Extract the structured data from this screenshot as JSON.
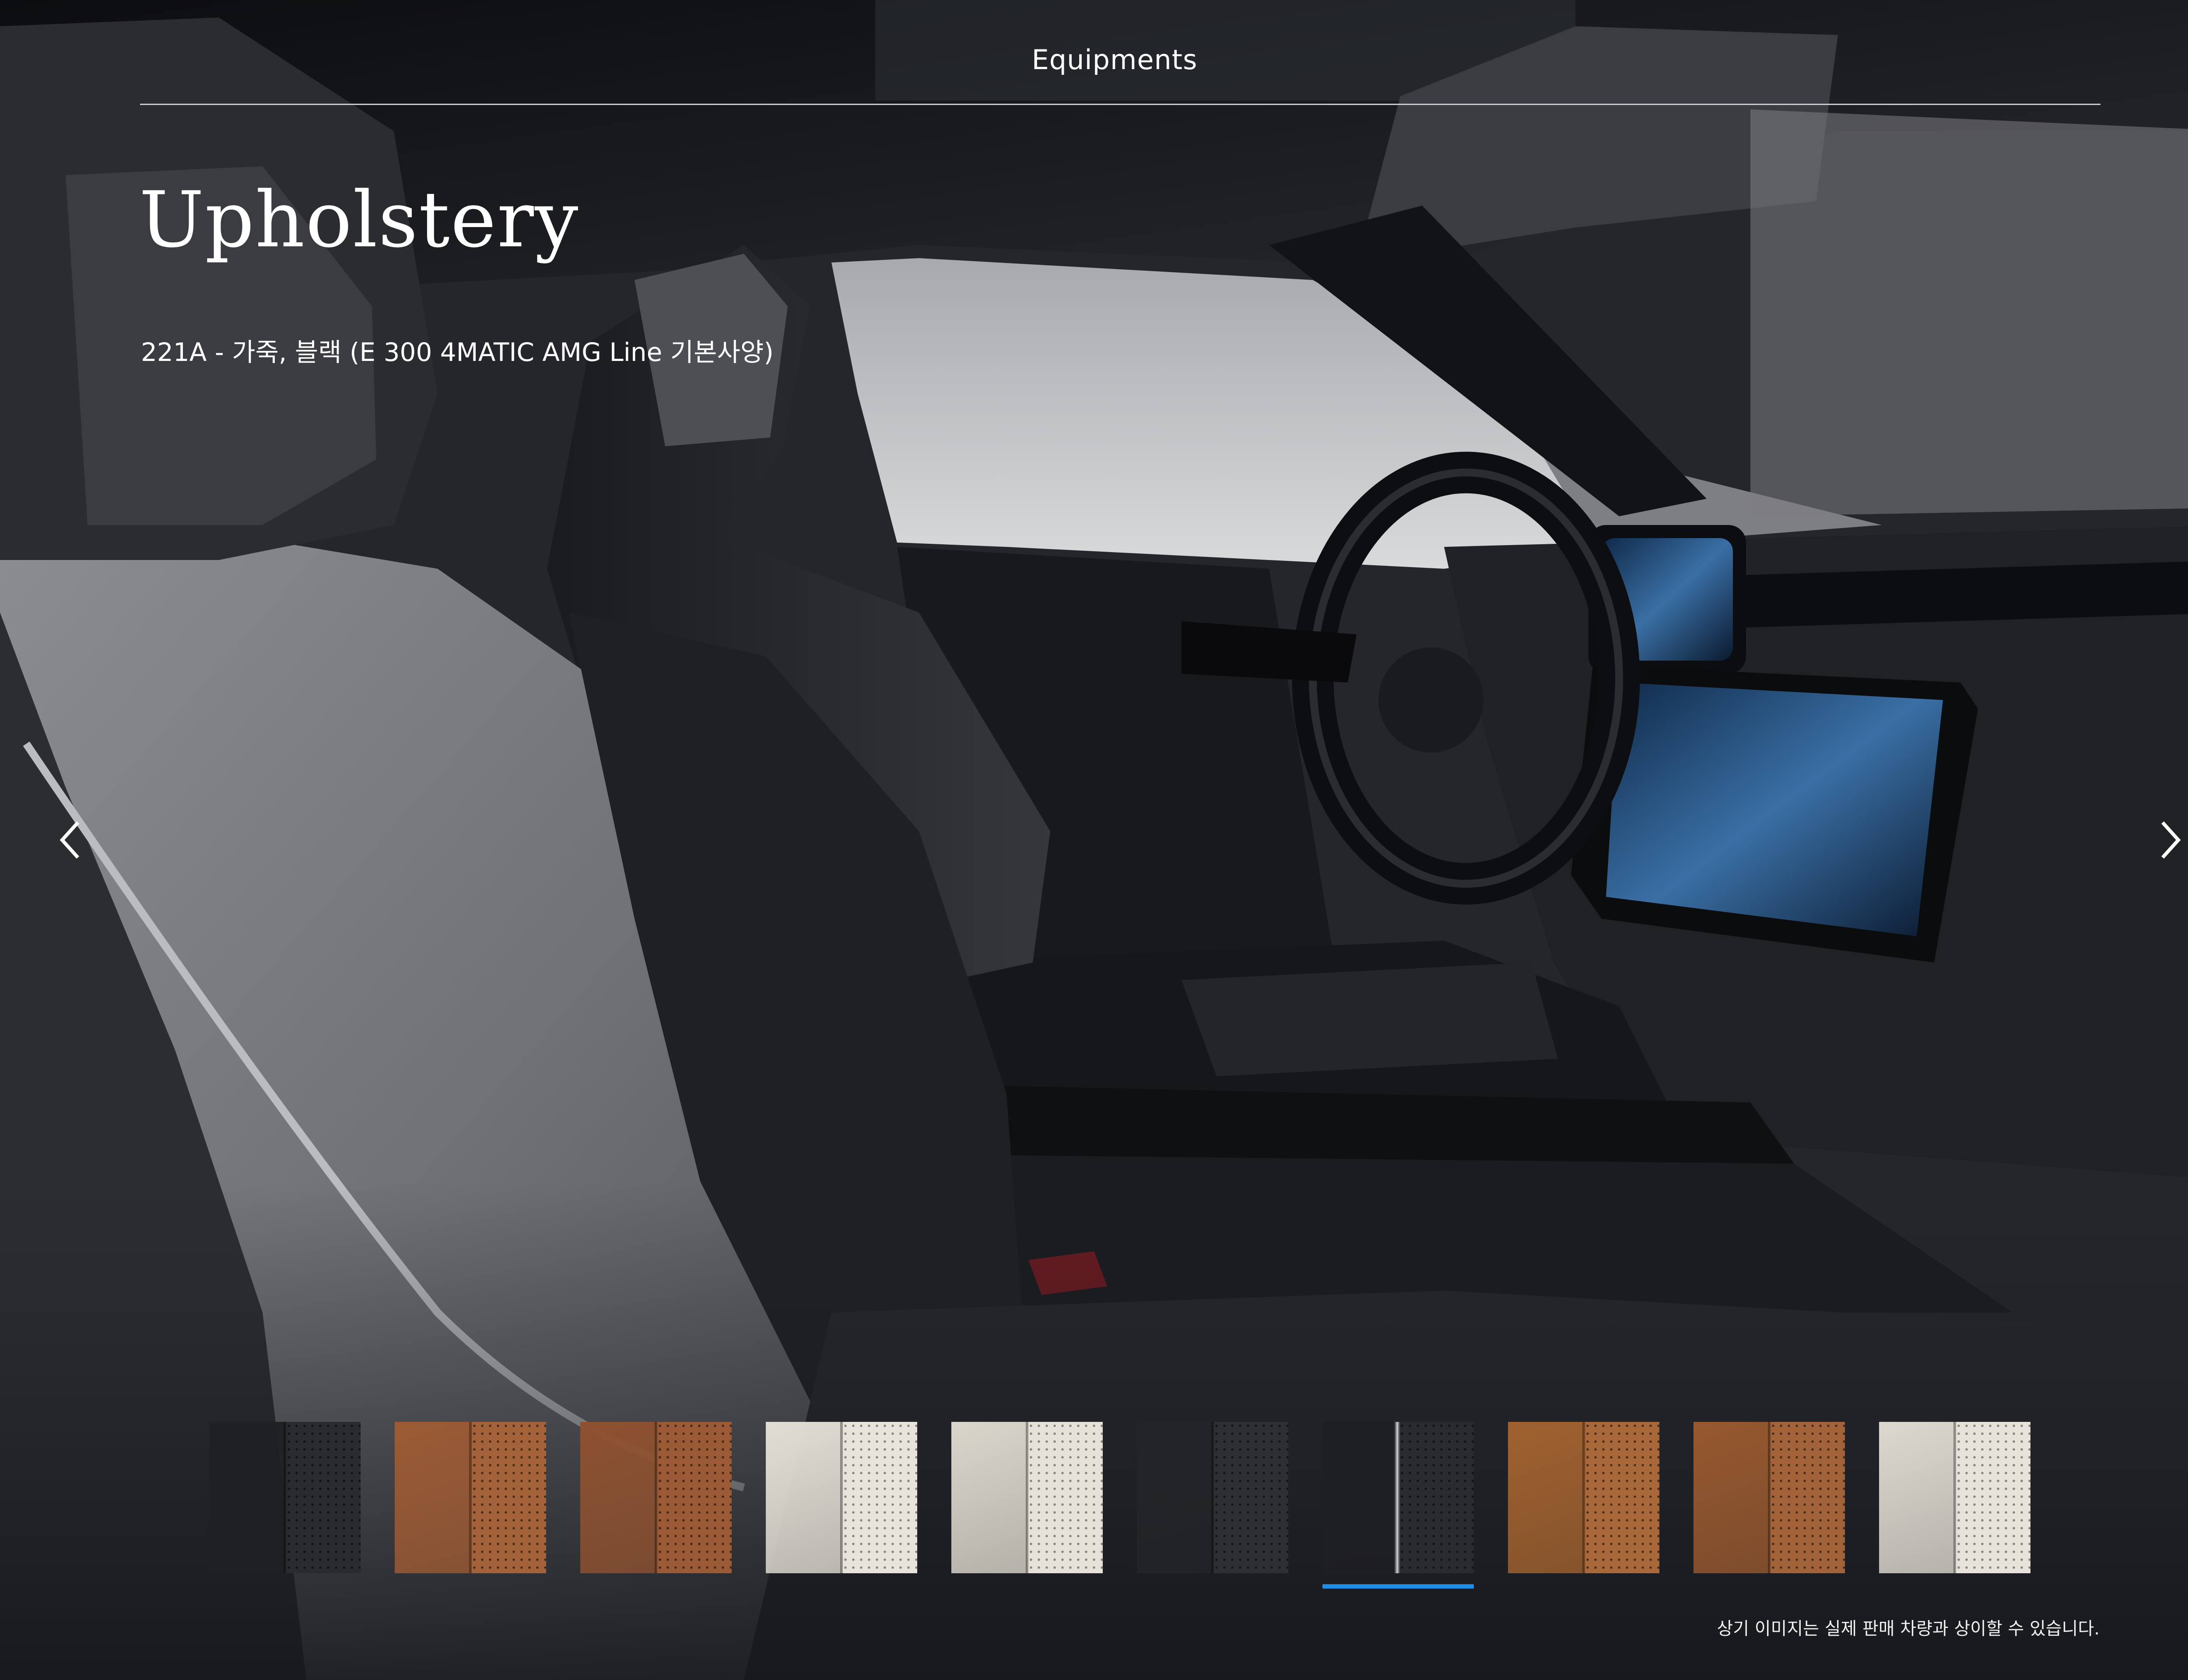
{
  "header": {
    "title": "Equipments"
  },
  "page": {
    "title": "Upholstery",
    "variant_label": "221A - 가죽, 블랙 (E 300 4MATIC AMG Line 기본사양)"
  },
  "nav": {
    "prev_icon": "chevron-left-icon",
    "next_icon": "chevron-right-icon"
  },
  "swatches": [
    {
      "name": "black-leather",
      "left": "#1f2023",
      "right": "#2a2b2e",
      "perforated": true,
      "selected": false
    },
    {
      "name": "brown-leather",
      "left": "#9b5a34",
      "right": "#a4623a",
      "perforated": true,
      "selected": false
    },
    {
      "name": "brown-leather",
      "left": "#8d5130",
      "right": "#9a5a36",
      "perforated": true,
      "selected": false
    },
    {
      "name": "white-leather",
      "left": "#e2ddd4",
      "right": "#e8e4dc",
      "perforated": true,
      "selected": false
    },
    {
      "name": "white-leather",
      "left": "#dbd6cc",
      "right": "#e6e2da",
      "perforated": true,
      "selected": false
    },
    {
      "name": "black-leather",
      "left": "#232427",
      "right": "#2e2f33",
      "perforated": true,
      "selected": false
    },
    {
      "name": "black-leather-piping",
      "left": "#1e1f22",
      "right": "#2a2b2f",
      "perforated": true,
      "piping": true,
      "selected": true
    },
    {
      "name": "brown-leather",
      "left": "#a0612f",
      "right": "#a8683a",
      "perforated": true,
      "selected": false
    },
    {
      "name": "brown-leather",
      "left": "#96582f",
      "right": "#a2633a",
      "perforated": true,
      "selected": false
    },
    {
      "name": "white-leather",
      "left": "#ddd8cf",
      "right": "#e7e3db",
      "perforated": true,
      "selected": false
    }
  ],
  "disclaimer": "상기 이미지는 실제 판매 차량과 상이할 수 있습니다.",
  "colors": {
    "accent": "#1d8fe8"
  }
}
